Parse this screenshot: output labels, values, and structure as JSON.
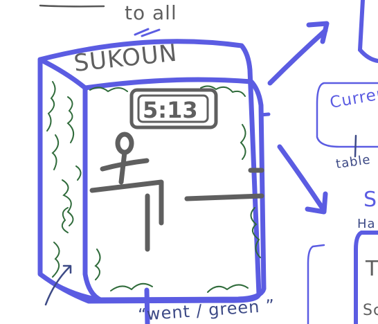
{
  "canvas": {
    "background": "#ffffff"
  },
  "colors": {
    "blue": "#5b5ce2",
    "navy": "#3d4a86",
    "gray": "#5f5f5f",
    "green": "#2f6b3a",
    "text_gray": "#565656"
  },
  "sketch": {
    "top_words": "to  all",
    "booth_title": "SUKOUN",
    "clock_time": "5:13",
    "right_label": "Current",
    "right_sub": "table",
    "right_s": "S",
    "right_ha": "Ha",
    "right_t": "T",
    "right_sc": "Sc",
    "bottom_words": "“went / green ”"
  },
  "icons": [
    "blue-box-outline",
    "green-vine-doodle",
    "stick-figure-icon",
    "digital-clock-icon",
    "arrow-up-right-icon",
    "arrow-down-right-icon"
  ]
}
